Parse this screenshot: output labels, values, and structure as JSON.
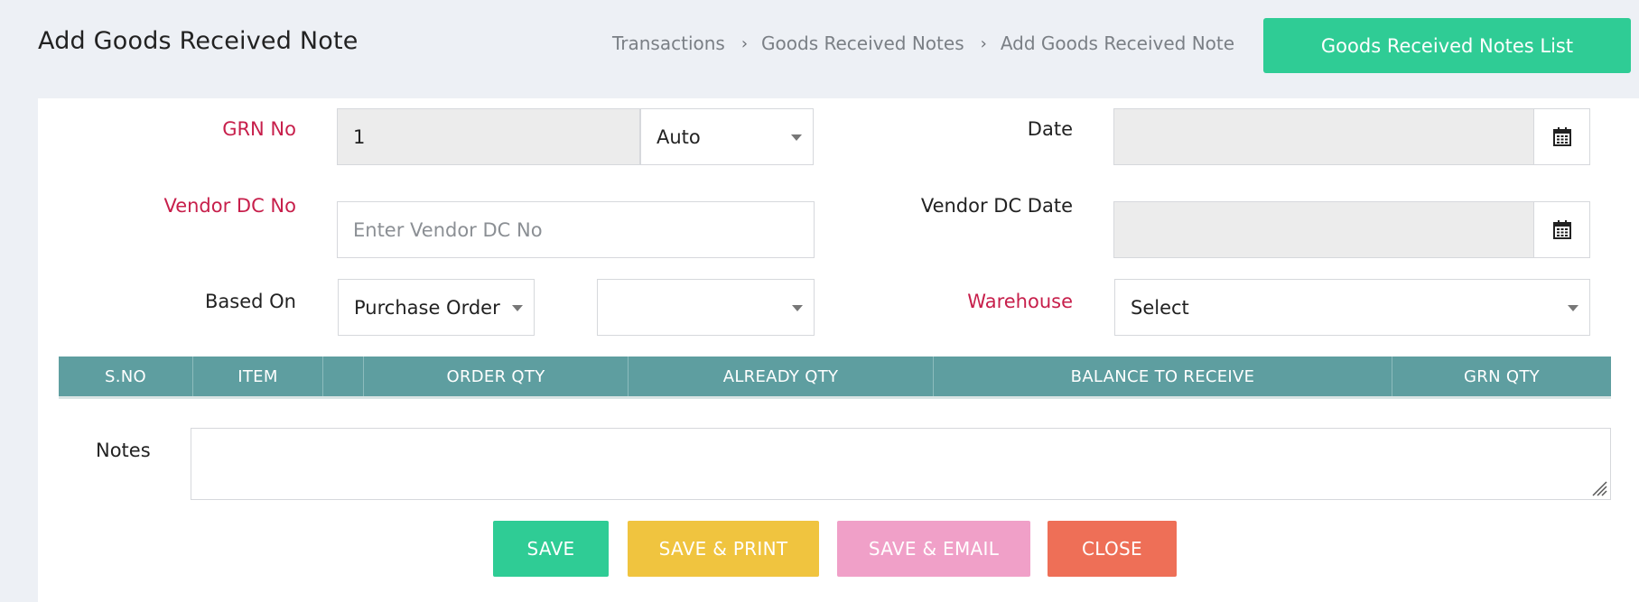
{
  "header": {
    "title": "Add Goods Received Note",
    "breadcrumb": [
      "Transactions",
      "Goods Received Notes",
      "Add Goods Received Note"
    ],
    "list_button": "Goods Received Notes List"
  },
  "form": {
    "grn_no": {
      "label": "GRN No",
      "value": "1",
      "mode": "Auto"
    },
    "date": {
      "label": "Date",
      "value": ""
    },
    "vendor_dc_no": {
      "label": "Vendor DC No",
      "placeholder": "Enter Vendor DC No"
    },
    "vendor_dc_date": {
      "label": "Vendor DC Date",
      "value": ""
    },
    "based_on": {
      "label": "Based On",
      "value": "Purchase Order",
      "reference": ""
    },
    "warehouse": {
      "label": "Warehouse",
      "value": "Select"
    }
  },
  "table": {
    "columns": [
      "S.NO",
      "ITEM",
      "",
      "ORDER QTY",
      "ALREADY QTY",
      "BALANCE TO RECEIVE",
      "GRN QTY"
    ]
  },
  "notes": {
    "label": "Notes",
    "value": ""
  },
  "actions": {
    "save": "SAVE",
    "save_print": "SAVE & PRINT",
    "save_email": "SAVE & EMAIL",
    "close": "CLOSE"
  },
  "colors": {
    "accent_green": "#2fcc95",
    "table_header": "#5e9ea0",
    "required_label": "#c71f4b",
    "save_print": "#f0c43f",
    "save_email": "#f0a0c8",
    "close": "#ee6f57",
    "page_background": "#edf0f5"
  }
}
